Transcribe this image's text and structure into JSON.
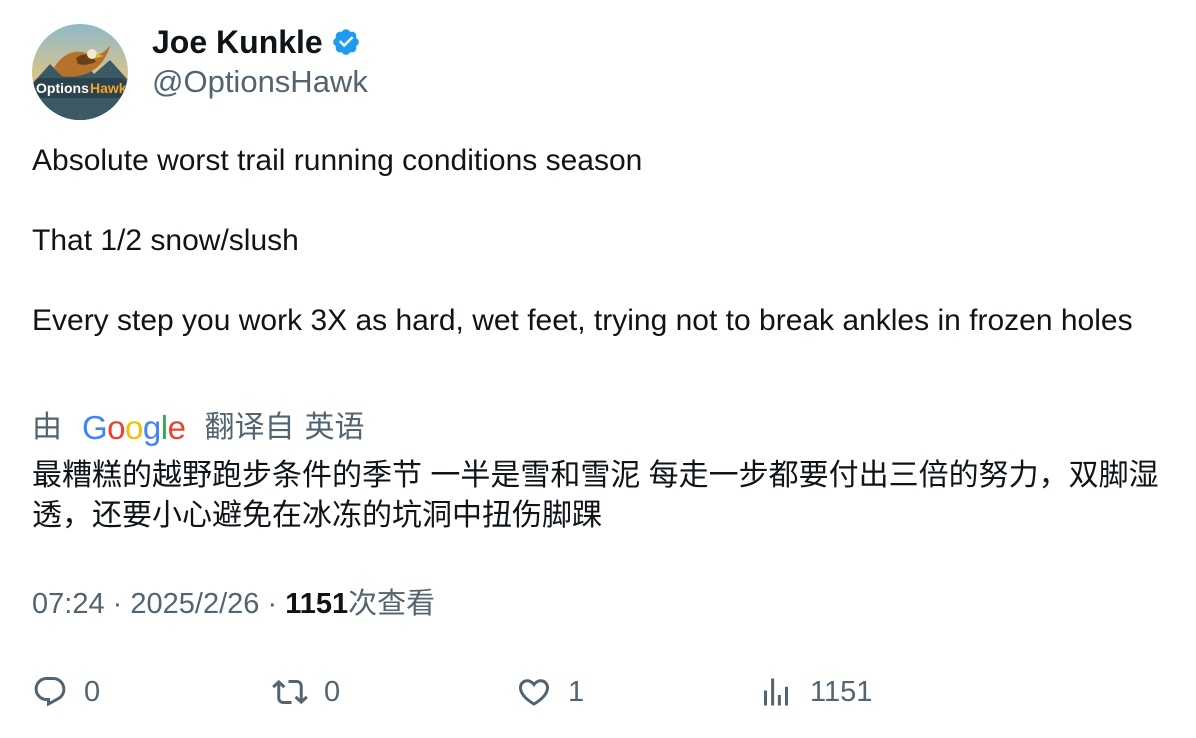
{
  "author": {
    "name": "Joe Kunkle",
    "handle": "@OptionsHawk",
    "avatar_text": "OptionsHawk",
    "verified": true
  },
  "tweet": {
    "line1": "Absolute worst trail running conditions season",
    "line2": "That 1/2 snow/slush",
    "line3": "Every step you work 3X as hard, wet feet, trying not to break ankles in frozen holes"
  },
  "translation": {
    "by": "由",
    "provider": "Google",
    "from_label": "翻译自",
    "source_language": "英语",
    "text": "最糟糕的越野跑步条件的季节 一半是雪和雪泥 每走一步都要付出三倍的努力，双脚湿透，还要小心避免在冰冻的坑洞中扭伤脚踝"
  },
  "meta": {
    "time": "07:24",
    "separator": "·",
    "date": "2025/2/26",
    "view_count": "1151",
    "views_label": "次查看"
  },
  "actions": {
    "replies": "0",
    "reposts": "0",
    "likes": "1",
    "views": "1151"
  },
  "colors": {
    "text_primary": "#0f1419",
    "text_secondary": "#536471",
    "verified_blue": "#1d9bf0"
  }
}
